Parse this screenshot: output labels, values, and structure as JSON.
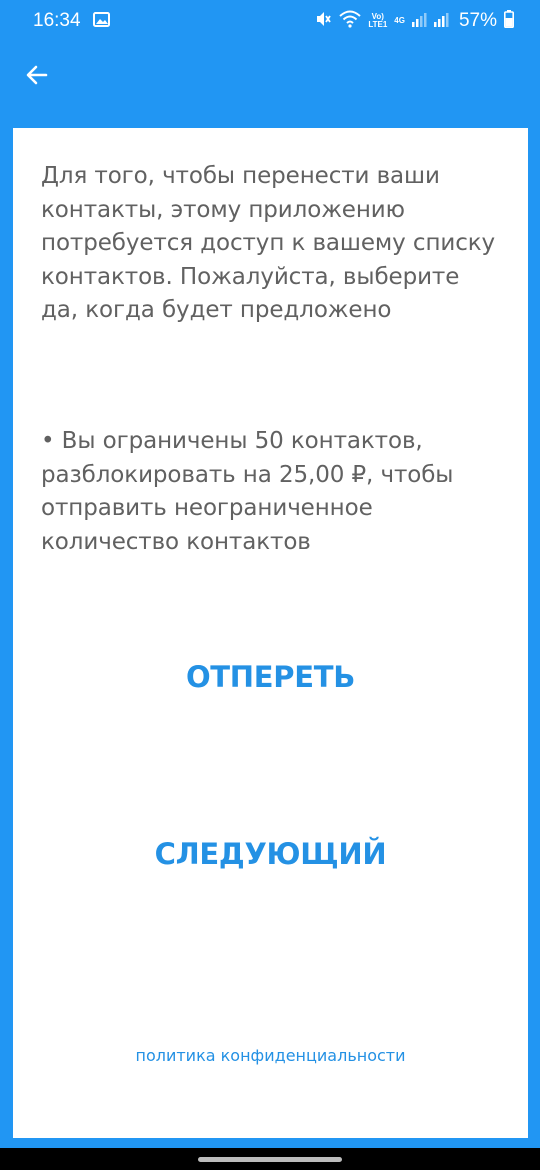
{
  "status_bar": {
    "time": "16:34",
    "volte_top": "Vo)",
    "volte_bottom": "LTE1",
    "network_type": "4G",
    "battery_percent": "57%",
    "icons": [
      "gallery-icon",
      "mute-icon",
      "wifi-icon",
      "signal-icon",
      "battery-icon"
    ]
  },
  "app_bar": {
    "back_icon": "arrow-back-icon"
  },
  "content": {
    "intro_text": "Для того, чтобы перенести ваши контакты, этому приложению потребуется доступ к вашему списку контактов. Пожалуйста, выберите да, когда будет предложено",
    "limit_text": "• Вы ограничены 50 контактов, разблокировать на 25,00 ₽, чтобы отправить неограниченное количество контактов",
    "restore_label": "ОТПЕРЕТЬ",
    "next_label": "СЛЕДУЮЩИЙ",
    "privacy_label": "политика конфиденциальности"
  },
  "colors": {
    "primary": "#2196F3",
    "accent_text": "#2491E4",
    "body_text": "#616161",
    "card": "#FFFFFF"
  }
}
